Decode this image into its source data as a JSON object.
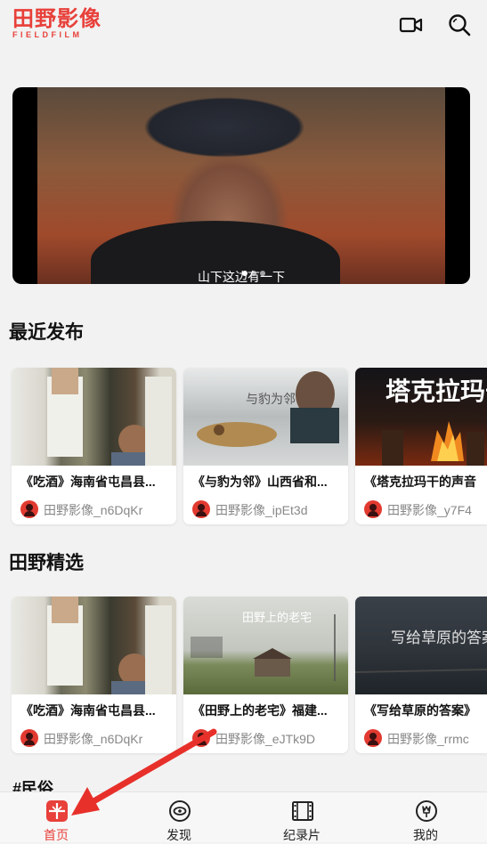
{
  "header": {
    "logo_cn": "田野影像",
    "logo_en": "FIELDFILM"
  },
  "banner": {
    "subtitle": "山下这边有一下"
  },
  "sections": [
    {
      "title": "最近发布",
      "cards": [
        {
          "title": "《吃酒》海南省屯昌县...",
          "author": "田野影像_n6DqKr"
        },
        {
          "title": "《与豹为邻》山西省和...",
          "author": "田野影像_ipEt3d"
        },
        {
          "title": "《塔克拉玛干的声音",
          "author": "田野影像_y7F4"
        }
      ]
    },
    {
      "title": "田野精选",
      "cards": [
        {
          "title": "《吃酒》海南省屯昌县...",
          "author": "田野影像_n6DqKr"
        },
        {
          "title": "《田野上的老宅》福建...",
          "author": "田野影像_eJTk9D"
        },
        {
          "title": "《写给草原的答案》",
          "author": "田野影像_rrmc"
        }
      ]
    }
  ],
  "tag_heading": "#民俗",
  "nav": {
    "home": "首页",
    "discover": "发现",
    "documentary": "纪录片",
    "mine": "我的"
  },
  "thumb_text": {
    "leopard": "与豹为邻",
    "takla": "塔克拉玛干",
    "house": "田野上的老宅",
    "grass": "写给草原的答案"
  },
  "colors": {
    "accent": "#e8403a"
  }
}
